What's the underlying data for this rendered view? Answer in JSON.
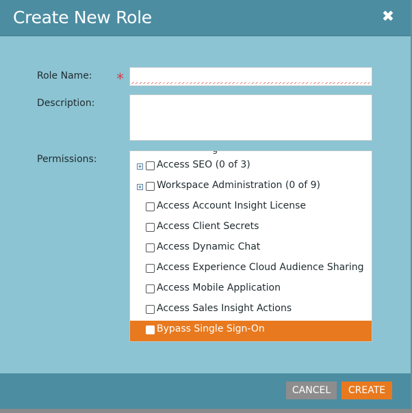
{
  "dialog": {
    "title": "Create New Role",
    "close_glyph": "✖",
    "close_icon": "close-icon"
  },
  "form": {
    "role_name_label": "Role Name:",
    "required_marker": "*",
    "role_name_value": "",
    "description_label": "Description:",
    "description_value": "",
    "permissions_label": "Permissions:"
  },
  "permissions": {
    "partial_hidden_row": "g",
    "items": [
      {
        "label": "Access SEO (0 of 3)",
        "expandable": true,
        "checked": false,
        "selected": false
      },
      {
        "label": "Workspace Administration (0 of 9)",
        "expandable": true,
        "checked": false,
        "selected": false
      },
      {
        "label": "Access Account Insight License",
        "expandable": false,
        "checked": false,
        "selected": false
      },
      {
        "label": "Access Client Secrets",
        "expandable": false,
        "checked": false,
        "selected": false
      },
      {
        "label": "Access Dynamic Chat",
        "expandable": false,
        "checked": false,
        "selected": false
      },
      {
        "label": "Access Experience Cloud Audience Sharing",
        "expandable": false,
        "checked": false,
        "selected": false
      },
      {
        "label": "Access Mobile Application",
        "expandable": false,
        "checked": false,
        "selected": false
      },
      {
        "label": "Access Sales Insight Actions",
        "expandable": false,
        "checked": false,
        "selected": false
      },
      {
        "label": "Bypass Single Sign-On",
        "expandable": false,
        "checked": false,
        "selected": true
      }
    ]
  },
  "footer": {
    "cancel_label": "CANCEL",
    "create_label": "CREATE"
  },
  "colors": {
    "header": "#4c8da2",
    "body": "#8cc4d3",
    "accent_orange": "#e8791e",
    "cancel_gray": "#8d8d8d",
    "required_red": "#d0404a"
  }
}
